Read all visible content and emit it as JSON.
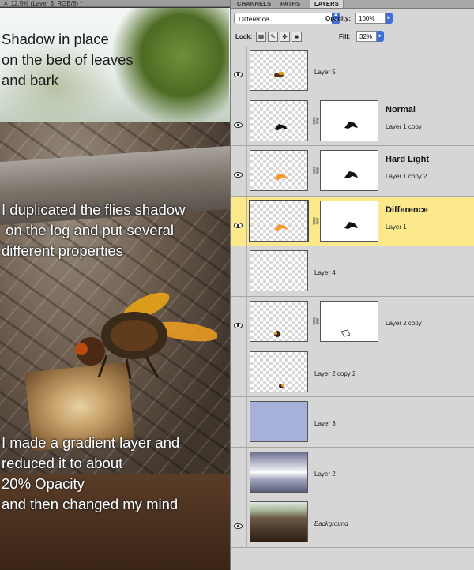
{
  "document": {
    "tab_title": "12.5% (Layer 3, RGB/8) *",
    "captions": [
      "Shadow in place\non the bed of leaves\nand bark",
      "I duplicated the flies shadow\n on the log and put several\ndifferent properties",
      "I made a gradient layer and\nreduced it to about\n20% Opacity\nand then changed my mind"
    ]
  },
  "panel": {
    "tabs": [
      "CHANNELS",
      "PATHS",
      "LAYERS"
    ],
    "active_tab": "LAYERS",
    "blend_mode": "Difference",
    "opacity_label": "Opacity:",
    "opacity_value": "100%",
    "lock_label": "Lock:",
    "lock_icons": [
      "lock-transparent-pixels-icon",
      "lock-image-pixels-icon",
      "lock-position-icon",
      "lock-all-icon"
    ],
    "fill_label": "Fill:",
    "fill_value": "32%"
  },
  "layers": [
    {
      "name": "Layer 5",
      "visible": true,
      "has_mask": false,
      "mode_label": "",
      "selected": false,
      "thumb": "fly-small"
    },
    {
      "name": "Layer 1 copy",
      "visible": true,
      "has_mask": true,
      "mode_label": "Normal",
      "selected": false,
      "thumb": "shadow-black"
    },
    {
      "name": "Layer 1 copy 2",
      "visible": true,
      "has_mask": true,
      "mode_label": "Hard Light",
      "selected": false,
      "thumb": "shadow-orange"
    },
    {
      "name": "Layer 1",
      "visible": true,
      "has_mask": true,
      "mode_label": "Difference",
      "selected": true,
      "thumb": "shadow-orange"
    },
    {
      "name": "Layer 4",
      "visible": false,
      "has_mask": false,
      "mode_label": "",
      "selected": false,
      "thumb": "empty"
    },
    {
      "name": "Layer 2 copy",
      "visible": true,
      "has_mask": true,
      "mode_label": "",
      "selected": false,
      "thumb": "fly-tiny"
    },
    {
      "name": "Layer 2 copy 2",
      "visible": false,
      "has_mask": false,
      "mode_label": "",
      "selected": false,
      "thumb": "fly-tiny2"
    },
    {
      "name": "Layer 3",
      "visible": false,
      "has_mask": false,
      "mode_label": "",
      "selected": false,
      "thumb": "solid-blue"
    },
    {
      "name": "Layer 2",
      "visible": false,
      "has_mask": false,
      "mode_label": "",
      "selected": false,
      "thumb": "gradient-metal"
    },
    {
      "name": "Background",
      "visible": true,
      "has_mask": false,
      "mode_label": "",
      "selected": false,
      "thumb": "photo",
      "italic": true
    }
  ],
  "colors": {
    "selected_row": "#fbe98c",
    "layer3_fill": "#a6b0d9",
    "accent_blue": "#3f6fd6"
  }
}
